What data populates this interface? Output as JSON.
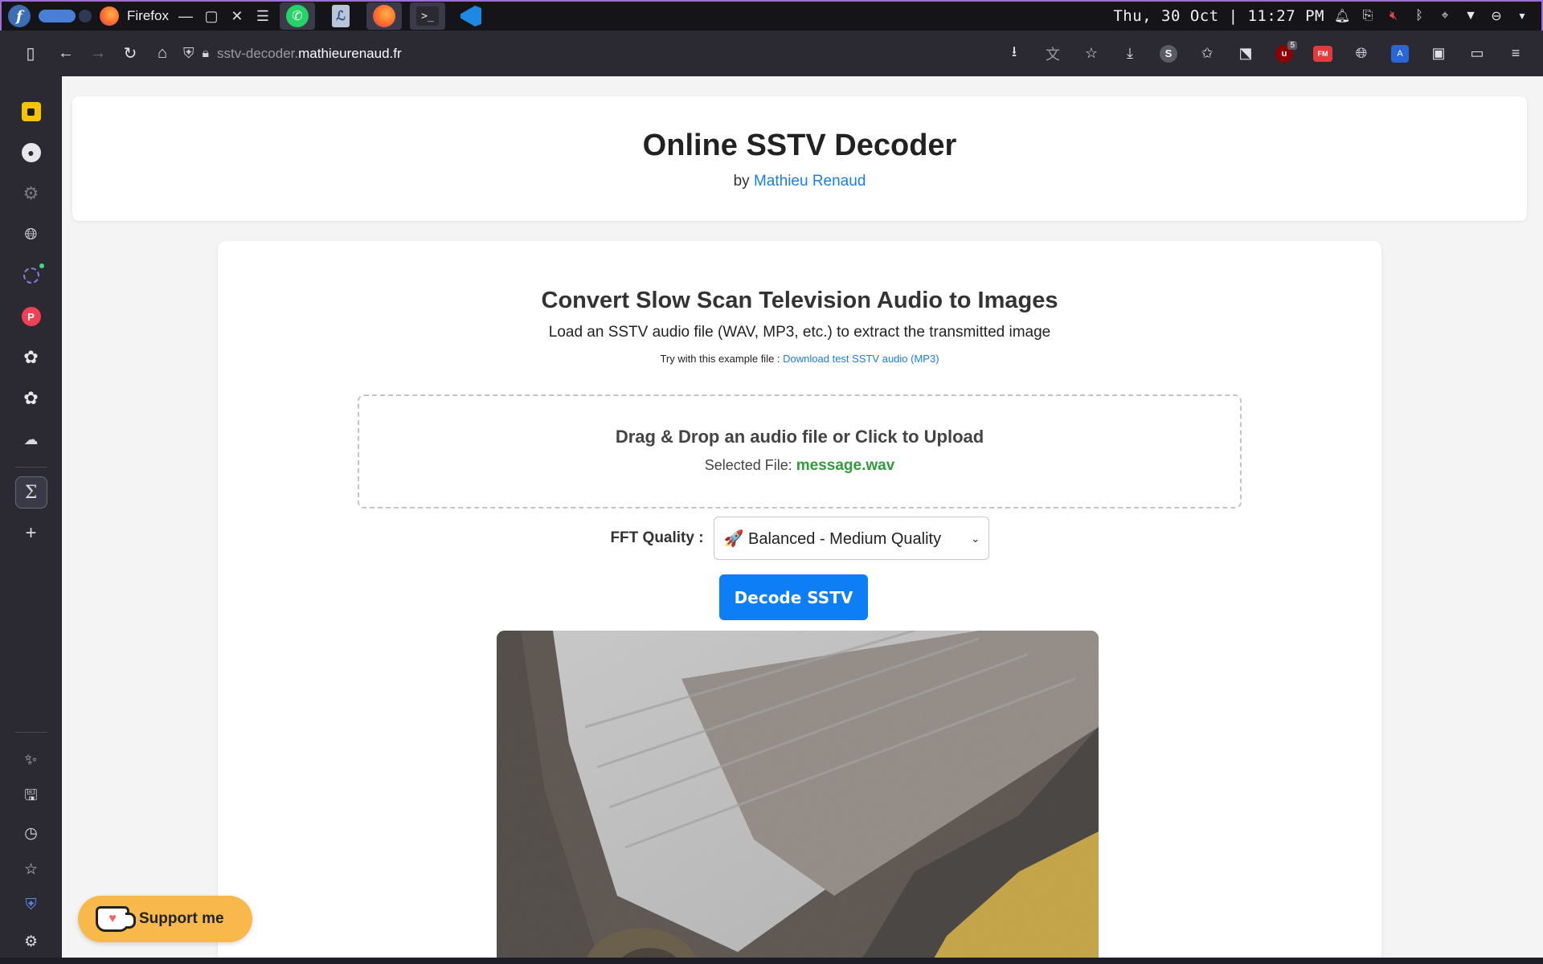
{
  "system_bar": {
    "app_title": "Firefox",
    "clock": "Thu, 30 Oct | 11:27 PM",
    "taskbar_apps": [
      "whatsapp",
      "document-viewer",
      "firefox",
      "terminal",
      "vscode"
    ]
  },
  "browser": {
    "url_subdomain": "sstv-decoder.",
    "url_domain": "mathieurenaud.fr",
    "extension_badge_count": "5",
    "ext_fm_label": "FM",
    "ext_translate_label": "A",
    "ext_s_label": "S"
  },
  "sidebar": {
    "items": [
      "notes-icon",
      "github-icon",
      "extension-gear-icon",
      "globe-icon",
      "loading-ring-icon",
      "pocket-icon",
      "chatgpt-icon",
      "chatgpt-icon-2",
      "mascot-icon",
      "sigma-icon",
      "add-icon"
    ],
    "bottom_items": [
      "sparkle-icon",
      "save-icon",
      "history-icon",
      "bookmarks-icon",
      "security-icon",
      "settings-icon"
    ],
    "sigma_label": "Σ"
  },
  "header": {
    "title": "Online SSTV Decoder",
    "by_prefix": "by ",
    "author": "Mathieu Renaud"
  },
  "main": {
    "heading": "Convert Slow Scan Television Audio to Images",
    "subtitle": "Load an SSTV audio file (WAV, MP3, etc.) to extract the transmitted image",
    "example_prefix": "Try with this example file : ",
    "example_link": "Download test SSTV audio (MP3)",
    "dropzone_title": "Drag & Drop an audio file or Click to Upload",
    "selected_prefix": "Selected File: ",
    "selected_file": "message.wav",
    "quality_label": "FFT Quality :",
    "quality_value": "🚀 Balanced - Medium Quality",
    "decode_button": "Decode SSTV"
  },
  "support": {
    "label": "Support me"
  },
  "colors": {
    "accent": "#0d7ef5",
    "link": "#1a7ee0",
    "file_green": "#2e9e3c",
    "support_bg": "#f9b84c"
  }
}
